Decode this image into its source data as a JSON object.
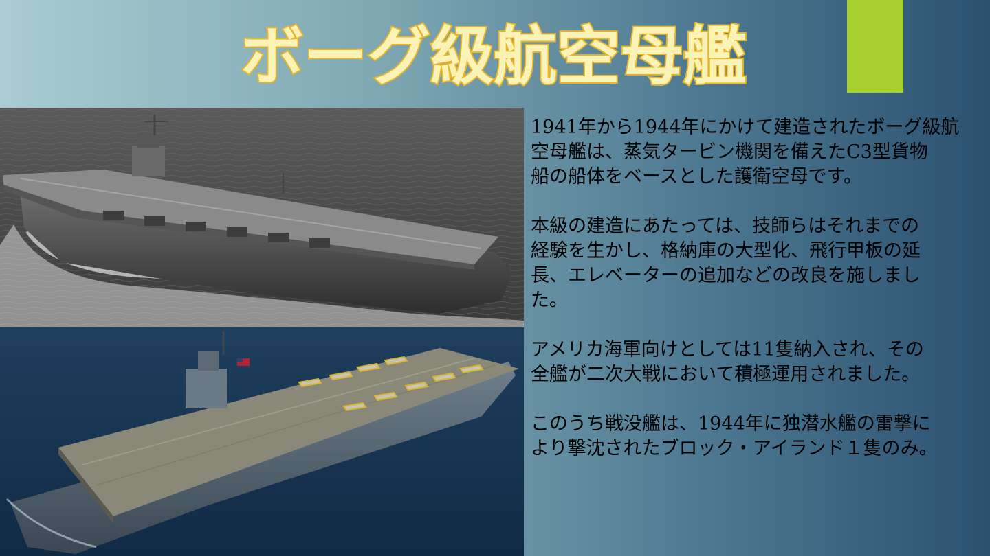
{
  "slide": {
    "title": "ボーグ級航空母艦",
    "paragraphs": [
      "1941年から1944年にかけて建造されたボーグ級航\n空母艦は、蒸気タービン機関を備えたC3型貨物\n船の船体をベースとした護衛空母です。",
      "本級の建造にあたっては、技師らはそれまでの\n経験を生かし、格納庫の大型化、飛行甲板の延\n長、エレベーターの追加などの改良を施しまし\nた。",
      "アメリカ海軍向けとしては11隻納入され、その\n全艦が二次大戦において積極運用されました。",
      "このうち戦没艦は、1944年に独潜水艦の雷撃に\nより撃沈されたブロック・アイランド１隻のみ。"
    ]
  },
  "colors": {
    "accent": "#a6cf2e",
    "title_fill": "#fbf3b6",
    "title_stroke": "#e7b52a"
  }
}
